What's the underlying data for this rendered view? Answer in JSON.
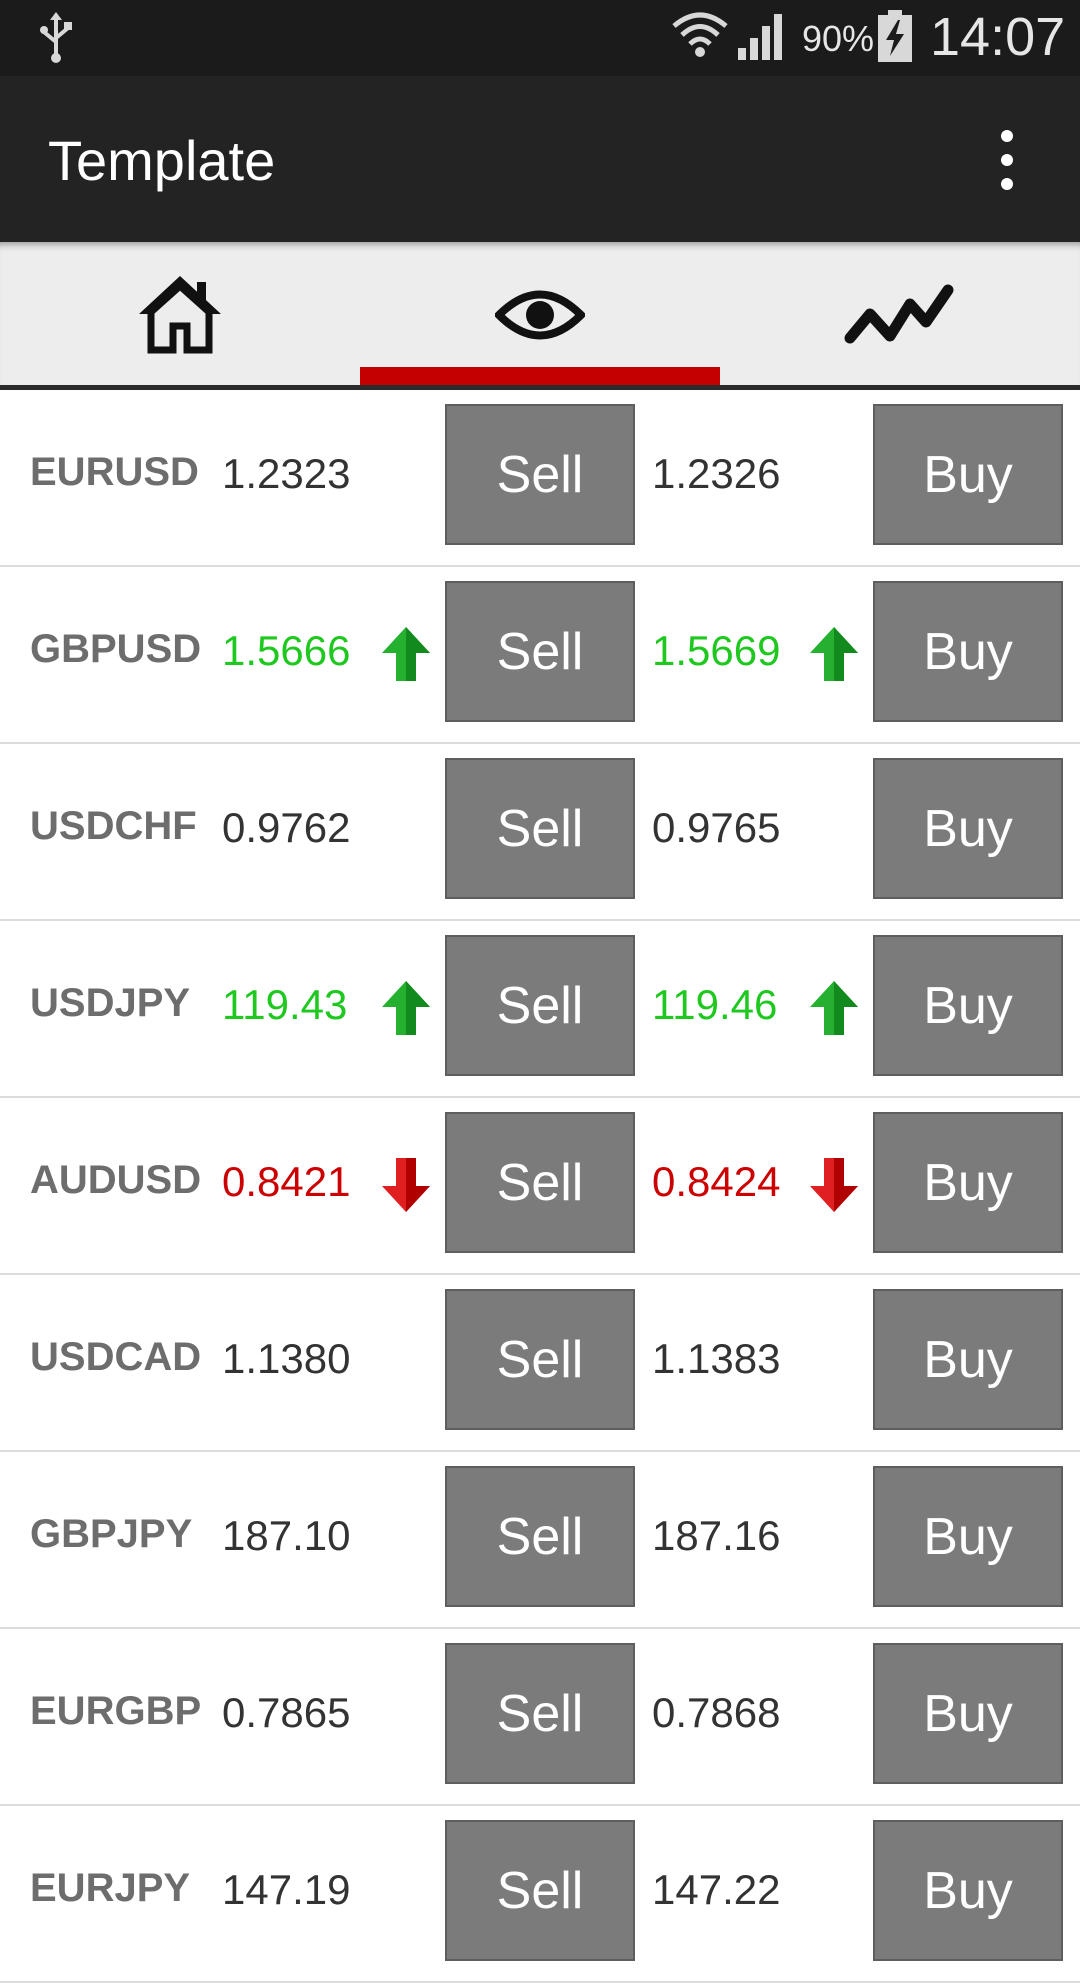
{
  "status_bar": {
    "battery_percent": "90%",
    "time": "14:07",
    "icons": [
      "usb-icon",
      "wifi-icon",
      "signal-icon",
      "battery-charging-icon"
    ]
  },
  "app_bar": {
    "title": "Template",
    "menu_icon": "overflow-menu-icon"
  },
  "tabs": [
    {
      "icon": "home-icon",
      "selected": false
    },
    {
      "icon": "eye-icon",
      "selected": true
    },
    {
      "icon": "chart-line-icon",
      "selected": false
    }
  ],
  "colors": {
    "accent": "#c40000",
    "up": "#1ec81e",
    "down": "#cc0000",
    "button": "#7b7b7b"
  },
  "quotes": [
    {
      "symbol": "EURUSD",
      "bid": "1.2323",
      "ask": "1.2326",
      "trend": "none",
      "sell_label": "Sell",
      "buy_label": "Buy"
    },
    {
      "symbol": "GBPUSD",
      "bid": "1.5666",
      "ask": "1.5669",
      "trend": "up",
      "sell_label": "Sell",
      "buy_label": "Buy"
    },
    {
      "symbol": "USDCHF",
      "bid": "0.9762",
      "ask": "0.9765",
      "trend": "none",
      "sell_label": "Sell",
      "buy_label": "Buy"
    },
    {
      "symbol": "USDJPY",
      "bid": "119.43",
      "ask": "119.46",
      "trend": "up",
      "sell_label": "Sell",
      "buy_label": "Buy"
    },
    {
      "symbol": "AUDUSD",
      "bid": "0.8421",
      "ask": "0.8424",
      "trend": "down",
      "sell_label": "Sell",
      "buy_label": "Buy"
    },
    {
      "symbol": "USDCAD",
      "bid": "1.1380",
      "ask": "1.1383",
      "trend": "none",
      "sell_label": "Sell",
      "buy_label": "Buy"
    },
    {
      "symbol": "GBPJPY",
      "bid": "187.10",
      "ask": "187.16",
      "trend": "none",
      "sell_label": "Sell",
      "buy_label": "Buy"
    },
    {
      "symbol": "EURGBP",
      "bid": "0.7865",
      "ask": "0.7868",
      "trend": "none",
      "sell_label": "Sell",
      "buy_label": "Buy"
    },
    {
      "symbol": "EURJPY",
      "bid": "147.19",
      "ask": "147.22",
      "trend": "none",
      "sell_label": "Sell",
      "buy_label": "Buy"
    }
  ]
}
